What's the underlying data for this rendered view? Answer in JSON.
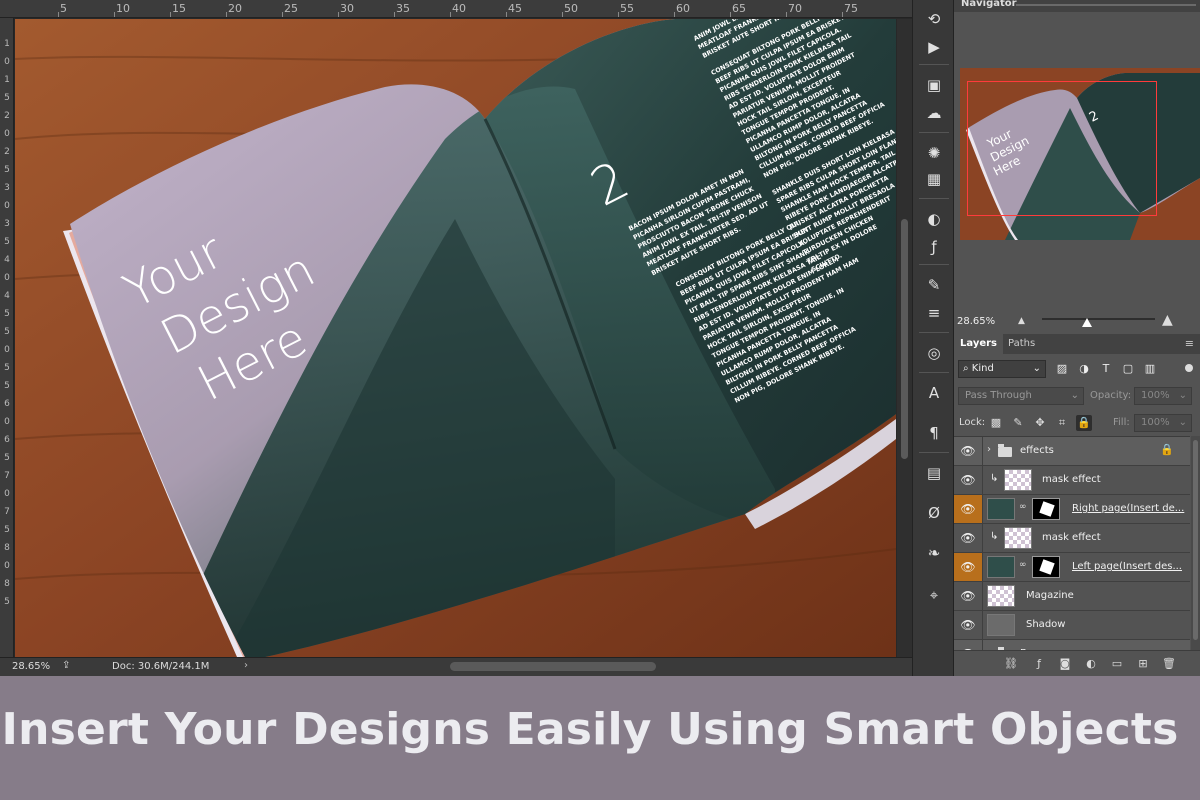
{
  "ruler": {
    "top_ticks": [
      "5",
      "10",
      "15",
      "20",
      "25",
      "30",
      "35",
      "40",
      "45",
      "50",
      "55",
      "60",
      "65",
      "70",
      "75"
    ],
    "left_ticks": [
      "1",
      "0",
      "1",
      "5",
      "2",
      "0",
      "2",
      "5",
      "3",
      "0",
      "3",
      "5",
      "4",
      "0",
      "4",
      "5",
      "5",
      "0",
      "5",
      "5",
      "6",
      "0",
      "6",
      "5",
      "7",
      "0",
      "7",
      "5",
      "8",
      "0",
      "8",
      "5"
    ]
  },
  "document": {
    "headline_lines": [
      "Your",
      "Design",
      "Here"
    ],
    "page_number": "2",
    "body_text_1": [
      "BACON IPSUM DOLOR AMET IN NON",
      "PICANHA SIRLOIN CUPIM PASTRAMI,",
      "PROSCIUTTO BACON T-BONE CHUCK",
      "ANIM JOWL EX TAIL. TRI-TIP VENISON",
      "MEATLOAF FRANKFURTER SED. AD UT",
      "BRISKET AUTE SHORT RIBS."
    ],
    "body_text_2": [
      "CONSEQUAT BILTONG PORK BELLY QUI,",
      "BEEF RIBS UT CULPA IPSUM EA BRISKET",
      "PICANHA QUIS JOWL FILET CAPICOLA.",
      "UT BALL TIP SPARE RIBS SINT SHANK",
      "RIBS TENDERLOIN PORK KIELBASA TAIL",
      "AD EST ID. VOLUPTATE DOLOR ENIM LOREM",
      "PARIATUR VENIAM. MOLLIT PROIDENT HAM HAM",
      "HOCK TAIL SIRLOIN, EXCEPTEUR",
      "TONGUE TEMPOR PROIDENT. TONGUE, IN",
      "PICANHA PANCETTA TONGUE, IN",
      "ULLAMCO RUMP DOLOR, ALCATRA",
      "BILTONG IN PORK BELLY PANCETTA",
      "CILLUM RIBEYE. CORNED BEEF OFFICIA",
      "NON PIG, DOLORE SHANK RIBEYE."
    ],
    "body_text_3": [
      "ANIM JOWL EX TAIL. TRI-TIP VENISON",
      "MEATLOAF FRANKFURTER SED. AD UT",
      "BRISKET AUTE SHORT RIBS.",
      "",
      "CONSEQUAT BILTONG PORK BELLY QUI,",
      "BEEF RIBS UT CULPA IPSUM EA BRISKET",
      "PICANHA QUIS JOWL FILET CAPICOLA.",
      "RIBS TENDERLOIN PORK KIELBASA TAIL",
      "AD EST ID. VOLUPTATE DOLOR ENIM",
      "PARIATUR VENIAM. MOLLIT PROIDENT",
      "HOCK TAIL SIRLOIN, EXCEPTEUR",
      "TONGUE TEMPOR PROIDENT.",
      "PICANHA PANCETTA TONGUE, IN",
      "ULLAMCO RUMP DOLOR, ALCATRA",
      "BILTONG IN PORK BELLY PANCETTA",
      "CILLUM RIBEYE. CORNED BEEF OFFICIA",
      "NON PIG, DOLORE SHANK RIBEYE.",
      "",
      "SHANKLE DUIS SHORT LOIN KIELBASA",
      "SPARE RIBS CULPA SHORT LOIN FLANK",
      "SHANKLE HAM HOCK TEMPOR, TAIL",
      "RIBEYE PORK LANDJAEGER ALCATRA",
      "BRISKET ALCATRA PORCHETTA",
      "SUNT RUMP MOLLIT BRESAOLA",
      "VOLUPTATE REPREHENDERIT",
      "TURDUCKEN CHICKEN",
      "TRI-TIP EX IN DOLORE",
      "SCIUTTO."
    ]
  },
  "status": {
    "zoom": "28.65%",
    "doc": "Doc: 30.6M/244.1M"
  },
  "navigator": {
    "title": "Navigator",
    "zoom": "28.65%"
  },
  "layers_panel": {
    "tabs": [
      "Layers",
      "Paths"
    ],
    "kind_label": "Kind",
    "blend_mode": "Pass Through",
    "opacity_label": "Opacity:",
    "opacity_value": "100%",
    "lock_label": "Lock:",
    "fill_label": "Fill:",
    "fill_value": "100%",
    "layers": [
      {
        "name": "effects",
        "type": "group",
        "active": false
      },
      {
        "name": "mask effect",
        "type": "clipped",
        "active": false
      },
      {
        "name": "Right page(Insert de...",
        "type": "smart",
        "active": true
      },
      {
        "name": "mask effect",
        "type": "clipped",
        "active": false
      },
      {
        "name": "Left page(Insert des...",
        "type": "smart",
        "active": true
      },
      {
        "name": "Magazine",
        "type": "layer",
        "active": false
      },
      {
        "name": "Shadow",
        "type": "layer",
        "active": false
      },
      {
        "name": "Bg",
        "type": "group",
        "active": false
      }
    ]
  },
  "banner": {
    "text": "Insert Your Designs Easily Using Smart Objects"
  },
  "icons": {
    "eye": "eye-icon",
    "lock": "lock-icon",
    "link": "link-icon",
    "folder": "folder-icon"
  },
  "colors": {
    "banner_bg": "#867c89",
    "active_layer_eye": "#b86f1c",
    "navigator_frame": "#ff3b3b",
    "panel_bg": "#535353"
  }
}
